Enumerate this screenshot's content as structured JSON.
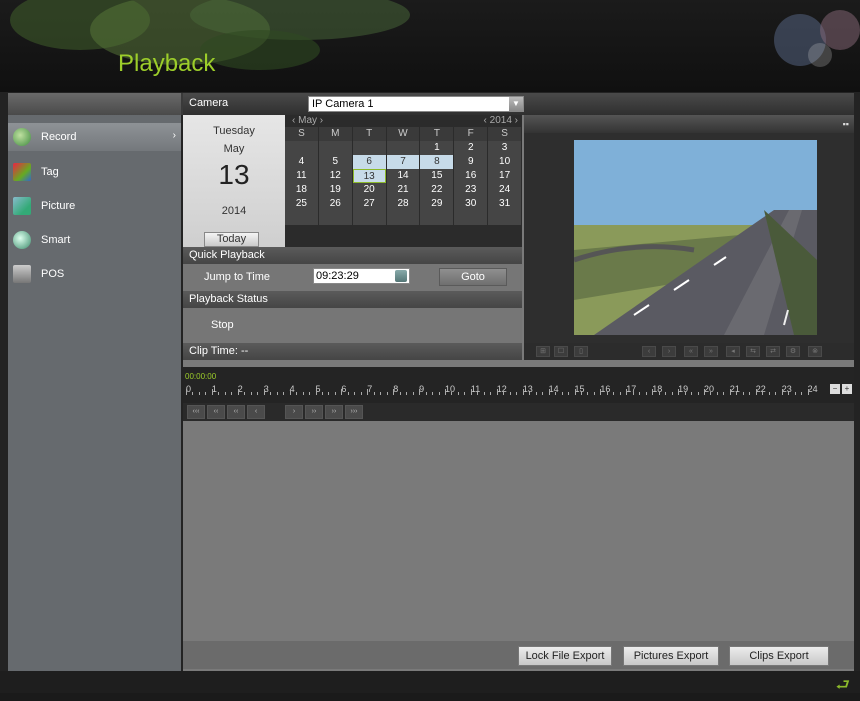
{
  "header": {
    "title": "Playback"
  },
  "camera": {
    "label": "Camera",
    "selected": "IP Camera 1"
  },
  "sidebar": {
    "items": [
      {
        "label": "Record",
        "icon": "record-icon",
        "active": true
      },
      {
        "label": "Tag",
        "icon": "tag-icon"
      },
      {
        "label": "Picture",
        "icon": "picture-icon"
      },
      {
        "label": "Smart",
        "icon": "smart-icon"
      },
      {
        "label": "POS",
        "icon": "pos-icon"
      }
    ]
  },
  "date": {
    "weekday": "Tuesday",
    "month": "May",
    "day": "13",
    "year": "2014",
    "today_label": "Today"
  },
  "calendar": {
    "month": "May",
    "year": "2014",
    "weekdays": [
      "S",
      "M",
      "T",
      "W",
      "T",
      "F",
      "S"
    ],
    "weeks": [
      [
        "",
        "",
        "",
        "",
        "1",
        "2",
        "3"
      ],
      [
        "4",
        "5",
        "6",
        "7",
        "8",
        "9",
        "10"
      ],
      [
        "11",
        "12",
        "13",
        "14",
        "15",
        "16",
        "17"
      ],
      [
        "18",
        "19",
        "20",
        "21",
        "22",
        "23",
        "24"
      ],
      [
        "25",
        "26",
        "27",
        "28",
        "29",
        "30",
        "31"
      ],
      [
        "",
        "",
        "",
        "",
        "",
        "",
        ""
      ]
    ],
    "record_days": [
      "6",
      "7",
      "8",
      "13"
    ],
    "selected_day": "13",
    "accent_color": "#8cba2b"
  },
  "quick_playback": {
    "title": "Quick Playback",
    "jump_label": "Jump to Time",
    "time_value": "09:23:29",
    "goto_label": "Goto"
  },
  "playback_status": {
    "title": "Playback Status",
    "status": "Stop"
  },
  "clip_time": "Clip Time: --",
  "timeline": {
    "current_time": "00:00:00",
    "hour_labels": [
      "0",
      "1",
      "2",
      "3",
      "4",
      "5",
      "6",
      "7",
      "8",
      "9",
      "10",
      "11",
      "12",
      "13",
      "14",
      "15",
      "16",
      "17",
      "18",
      "19",
      "20",
      "21",
      "22",
      "23",
      "24"
    ]
  },
  "playback_controls": [
    "‹‹‹",
    "‹‹",
    "‹‹",
    "‹",
    "›",
    "››",
    "››",
    "›››"
  ],
  "video_toolbar": [
    "⊞",
    "☐",
    "▯",
    "‹",
    "›",
    "«",
    "»",
    "◂",
    "⇆",
    "⇄",
    "⚙",
    "⊗"
  ],
  "export": {
    "lock": "Lock File Export",
    "pictures": "Pictures Export",
    "clips": "Clips Export"
  }
}
